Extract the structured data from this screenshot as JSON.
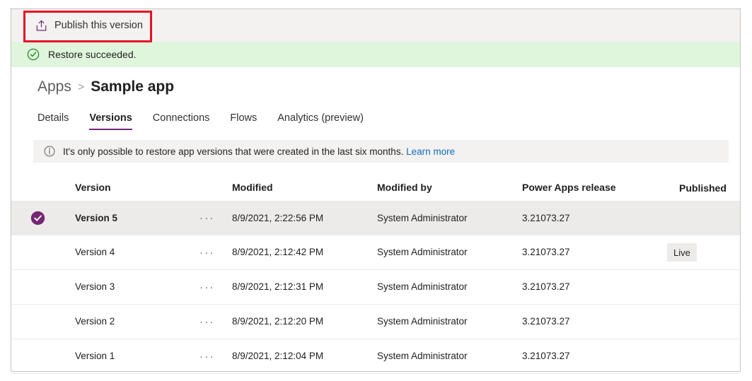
{
  "command_bar": {
    "publish_button_label": "Publish this version",
    "publish_icon": "upload-icon",
    "highlight_color": "#e81123"
  },
  "message_bar": {
    "icon": "check-circle-icon",
    "text": "Restore succeeded.",
    "background_color": "#dff6dd"
  },
  "breadcrumb": {
    "parent": "Apps",
    "separator": ">",
    "current": "Sample app"
  },
  "tabs": [
    {
      "label": "Details",
      "selected": false
    },
    {
      "label": "Versions",
      "selected": true
    },
    {
      "label": "Connections",
      "selected": false
    },
    {
      "label": "Flows",
      "selected": false
    },
    {
      "label": "Analytics (preview)",
      "selected": false
    }
  ],
  "info_bar": {
    "icon": "info-circle-icon",
    "text": "It's only possible to restore app versions that were created in the last six months.",
    "link_label": "Learn more"
  },
  "table": {
    "columns": [
      "Version",
      "Modified",
      "Modified by",
      "Power Apps release",
      "Published"
    ],
    "rows": [
      {
        "version": "Version 5",
        "modified": "8/9/2021, 2:22:56 PM",
        "modified_by": "System Administrator",
        "release": "3.21073.27",
        "published": "",
        "selected": true,
        "overflow_label": "···"
      },
      {
        "version": "Version 4",
        "modified": "8/9/2021, 2:12:42 PM",
        "modified_by": "System Administrator",
        "release": "3.21073.27",
        "published": "Live",
        "selected": false,
        "overflow_label": "···"
      },
      {
        "version": "Version 3",
        "modified": "8/9/2021, 2:12:31 PM",
        "modified_by": "System Administrator",
        "release": "3.21073.27",
        "published": "",
        "selected": false,
        "overflow_label": "···"
      },
      {
        "version": "Version 2",
        "modified": "8/9/2021, 2:12:20 PM",
        "modified_by": "System Administrator",
        "release": "3.21073.27",
        "published": "",
        "selected": false,
        "overflow_label": "···"
      },
      {
        "version": "Version 1",
        "modified": "8/9/2021, 2:12:04 PM",
        "modified_by": "System Administrator",
        "release": "3.21073.27",
        "published": "",
        "selected": false,
        "overflow_label": "···"
      }
    ]
  },
  "colors": {
    "accent_purple": "#742774",
    "link_blue": "#0f6cbd",
    "selected_row": "#edebe9",
    "command_bar_bg": "#f3f2f1",
    "success_green": "#107c10"
  }
}
